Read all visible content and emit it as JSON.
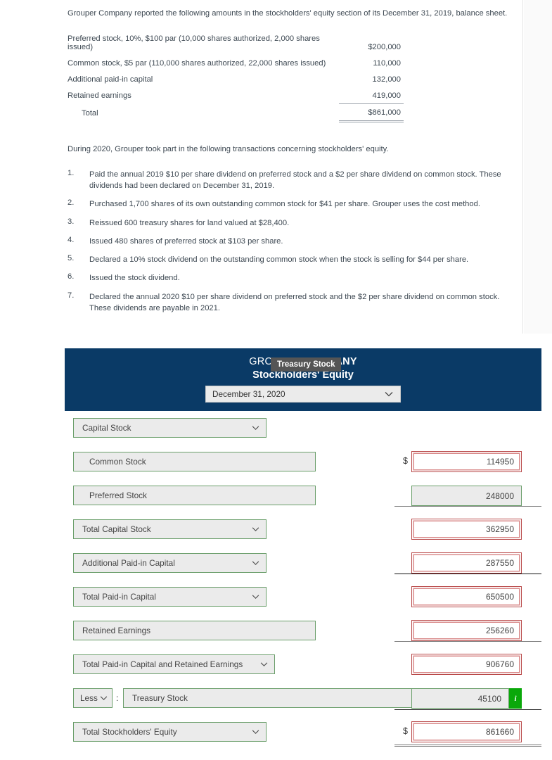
{
  "problem": {
    "intro": "Grouper Company reported the following amounts in the stockholders' equity section of its December 31, 2019, balance sheet.",
    "balance_sheet": [
      {
        "label": "Preferred stock, 10%, $100 par (10,000 shares authorized, 2,000 shares issued)",
        "amount": "$200,000"
      },
      {
        "label": "Common stock, $5 par (110,000 shares authorized, 22,000 shares issued)",
        "amount": "110,000"
      },
      {
        "label": "Additional paid-in capital",
        "amount": "132,000"
      },
      {
        "label": "Retained earnings",
        "amount": "419,000"
      },
      {
        "label": "Total",
        "amount": "$861,000"
      }
    ],
    "during_text": "During 2020, Grouper took part in the following transactions concerning stockholders' equity.",
    "transactions": [
      {
        "num": "1.",
        "text": "Paid the annual 2019 $10 per share dividend on preferred stock and a $2 per share dividend on common stock. These dividends had been declared on December 31, 2019."
      },
      {
        "num": "2.",
        "text": "Purchased 1,700 shares of its own outstanding common stock for $41 per share. Grouper uses the cost method."
      },
      {
        "num": "3.",
        "text": "Reissued 600 treasury shares for land valued at $28,400."
      },
      {
        "num": "4.",
        "text": "Issued 480 shares of preferred stock at $103 per share."
      },
      {
        "num": "5.",
        "text": "Declared a 10% stock dividend on the outstanding common stock when the stock is selling for $44 per share."
      },
      {
        "num": "6.",
        "text": "Issued the stock dividend."
      },
      {
        "num": "7.",
        "text": "Declared the annual 2020 $10 per share dividend on preferred stock and the $2 per share dividend on common stock. These dividends are payable in 2021."
      }
    ]
  },
  "statement": {
    "company_name_light": "GROUPER ",
    "company_name_bold": "COMPANY",
    "title": "Stockholders' Equity",
    "date_value": "December 31, 2020",
    "colors": {
      "header_blue": "#0a3a66",
      "valid_green": "#6a9e6a",
      "invalid_red": "#b94a4a",
      "info_green": "#0aa80a",
      "tooltip_gray": "#555555"
    },
    "rows": [
      {
        "label": "Capital Stock",
        "value": "",
        "dollar": ""
      },
      {
        "label": "Common Stock",
        "value": "114950",
        "dollar": "$"
      },
      {
        "label": "Preferred Stock",
        "value": "248000",
        "dollar": ""
      },
      {
        "label": "Total Capital Stock",
        "value": "362950",
        "dollar": ""
      },
      {
        "label": "Additional Paid-in Capital",
        "value": "287550",
        "dollar": ""
      },
      {
        "label": "Total Paid-in Capital",
        "value": "650500",
        "dollar": ""
      },
      {
        "label": "Retained Earnings",
        "value": "256260",
        "dollar": ""
      },
      {
        "label": "Total Paid-in Capital and Retained Earnings",
        "value": "906760",
        "dollar": ""
      },
      {
        "label": "Treasury Stock",
        "value": "45100",
        "dollar": "",
        "prefix_select": "Less",
        "colon": ":"
      },
      {
        "label": "Total Stockholders' Equity",
        "value": "861660",
        "dollar": "$"
      }
    ],
    "info_icon_label": "i",
    "tooltip_text": "Treasury Stock"
  }
}
